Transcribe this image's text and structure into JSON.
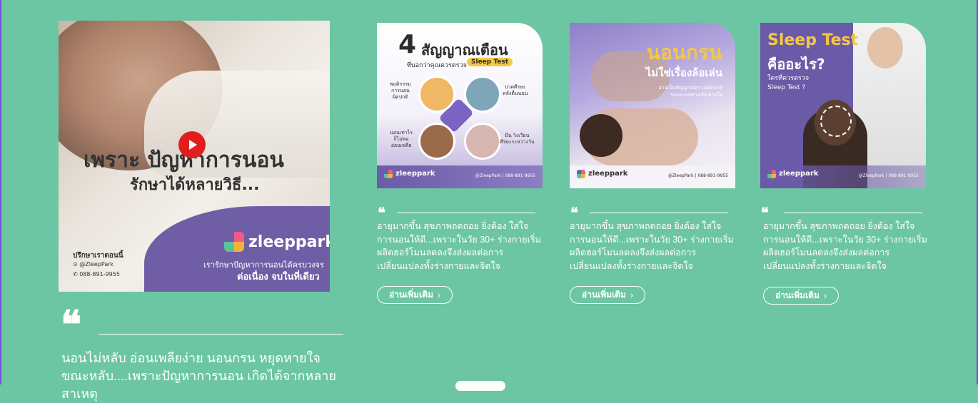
{
  "featured": {
    "headline_line1": "เพราะ ปัญหาการนอน",
    "headline_line2": "รักษาได้หลายวิธี...",
    "brand": "zleeppark",
    "tagline_line1": "เรารักษาปัญหาการนอนได้ครบวงจร",
    "tagline_line2": "ต่อเนื่อง จบในที่เดียว",
    "contact_title": "ปรึกษาเราตอนนี้",
    "contact_fb": "@ZleepPark",
    "contact_tel": "088-891-9955",
    "quote": "❝",
    "text": "นอนไม่หลับ อ่อนเพลียง่าย นอนกรน หยุดหายใจขณะหลับ....เพราะปัญหาการนอน เกิดได้จากหลายสาเหตุ"
  },
  "cards": [
    {
      "thumb": {
        "big4": "4",
        "title": "สัญญาณเตือน",
        "sub": "ที่บอกว่าคุณควรตรวจ",
        "pill": "Sleep Test",
        "label1": "พฤติกรรม\nการนอน\nผิดปกติ",
        "label2": "ปวดศีรษะ\nหลังตื่นนอน",
        "label3": "นอนเท่าไร\nก็ไม่พอ\nอ่อนเพลีย",
        "label4": "มึน วิงเวียน\nศีรษะระหว่างวัน",
        "logo": "zleeppark",
        "footer": "@ZleepPark   |   088-891-9955"
      },
      "quote": "❝",
      "excerpt": "อายุมากขึ้น สุขภาพถดถอย ยิ่งต้อง ใส่ใจการนอนให้ดี...เพราะในวัย 30+ ร่างกายเริ่มผลิตฮอร์โมนลดลงจึงส่งผลต่อการเปลี่ยนแปลงทั้งร่างกายและจิตใจ",
      "more_label": "อ่านเพิ่มเติม"
    },
    {
      "thumb": {
        "h1": "นอนกรน",
        "h2": "ไม่ใช่เรื่องล้อเล่น",
        "h3": "อาจเป็นสัญญาณความผิดปกติ\nของระบบทางเดินหายใจ",
        "logo": "zleeppark",
        "footer": "@ZleepPark   |   088-891-9955"
      },
      "quote": "❝",
      "excerpt": "อายุมากขึ้น สุขภาพถดถอย ยิ่งต้อง ใส่ใจการนอนให้ดี...เพราะในวัย 30+ ร่างกายเริ่มผลิตฮอร์โมนลดลงจึงส่งผลต่อการเปลี่ยนแปลงทั้งร่างกายและจิตใจ",
      "more_label": "อ่านเพิ่มเติม"
    },
    {
      "thumb": {
        "h1": "Sleep Test",
        "h2": "คืออะไร?",
        "h3": "ใครที่ควรตรวจ\nSleep Test ?",
        "logo": "zleeppark",
        "footer": "@ZleepPark   |   088-891-9955"
      },
      "quote": "❝",
      "excerpt": "อายุมากขึ้น สุขภาพถดถอย ยิ่งต้อง ใส่ใจการนอนให้ดี...เพราะในวัย 30+ ร่างกายเริ่มผลิตฮอร์โมนลดลงจึงส่งผลต่อการเปลี่ยนแปลงทั้งร่างกายและจิตใจ",
      "more_label": "อ่านเพิ่มเติม"
    }
  ],
  "icons": {
    "play": "youtube-play-icon",
    "quote": "quote-icon",
    "chevron": "chevron-right-icon"
  },
  "colors": {
    "background": "#6cc6a4",
    "brand_purple": "#6f5ea6",
    "youtube_red": "#e01e1e",
    "accent_yellow": "#f5c842"
  }
}
